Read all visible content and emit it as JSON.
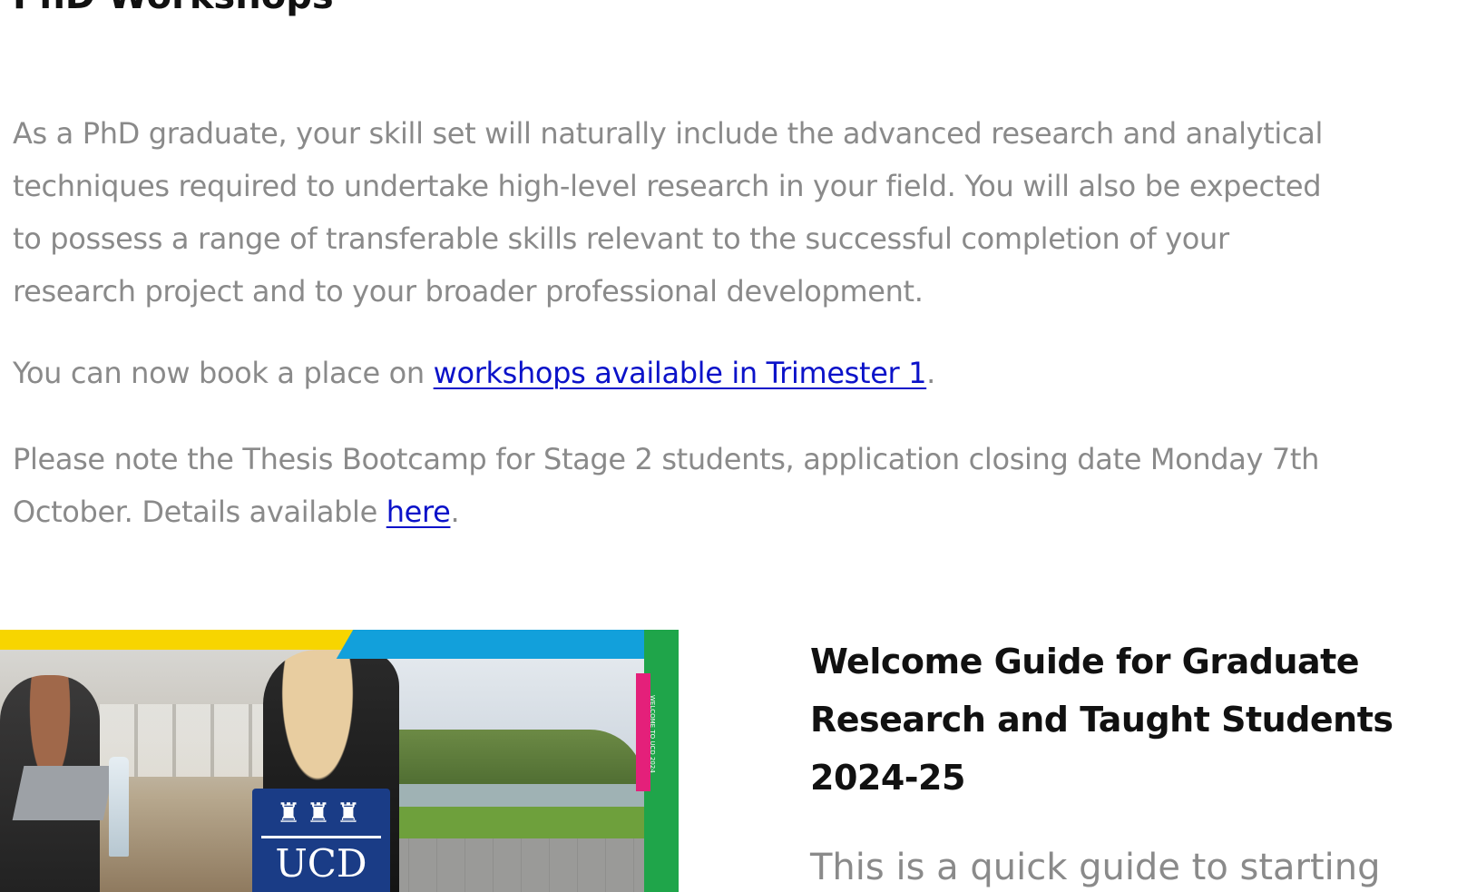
{
  "section": {
    "title": "PhD Workshops"
  },
  "intro": {
    "lines": [
      "As a PhD graduate, your skill set will naturally include the advanced research and analytical",
      "techniques required to undertake high-level research in your field. You will also be expected",
      "to possess a range of transferable skills relevant to the successful completion of your",
      "research project and to your broader professional development."
    ]
  },
  "booking": {
    "prefix": "You can now book a place on ",
    "link_label": "workshops available in Trimester 1",
    "suffix": "."
  },
  "note": {
    "line1": "Please note the Thesis Bootcamp for Stage 2 students, application closing date Monday 7th",
    "line2_prefix": "October. Details available ",
    "link_label": "here",
    "suffix": "."
  },
  "banner": {
    "crest_text": "UCD",
    "flag_text": "WELCOME TO UCD 2024"
  },
  "guide": {
    "title": "Welcome Guide for Graduate Research and Taught Students 2024-25",
    "text": "This is a quick guide to starting"
  },
  "colors": {
    "heading": "#111111",
    "body_text": "#8a8a8a",
    "link": "#0b12c9"
  }
}
